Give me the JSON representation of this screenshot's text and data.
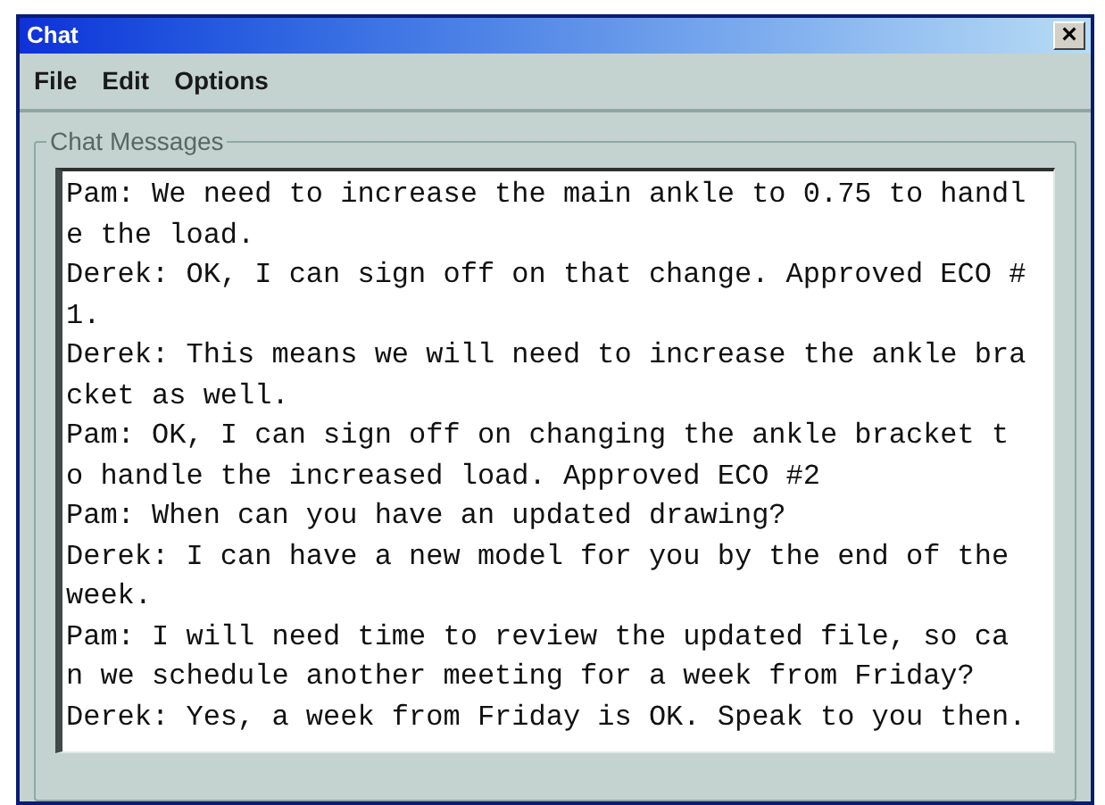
{
  "window": {
    "title": "Chat",
    "close": "×"
  },
  "menu": [
    {
      "label": "File"
    },
    {
      "label": "Edit"
    },
    {
      "label": "Options"
    }
  ],
  "group": {
    "title": "Chat Messages"
  },
  "messages": [
    {
      "text": "Pam: We need to increase the main ankle to 0.75 to handle the load."
    },
    {
      "text": "Derek: OK, I can sign off on that change. Approved ECO #1."
    },
    {
      "text": "Derek: This means we will need to increase the ankle bracket as well."
    },
    {
      "text": "Pam: OK, I can sign off on changing the ankle bracket to handle the increased load. Approved ECO #2"
    },
    {
      "text": "Pam: When can you have an updated drawing?"
    },
    {
      "text": "Derek: I can have a new model for you by the end of the week."
    },
    {
      "text": "Pam: I will need time to review the updated file, so can we schedule another meeting for a week from Friday?"
    },
    {
      "text": "Derek: Yes, a week from Friday is OK. Speak to you then."
    }
  ]
}
